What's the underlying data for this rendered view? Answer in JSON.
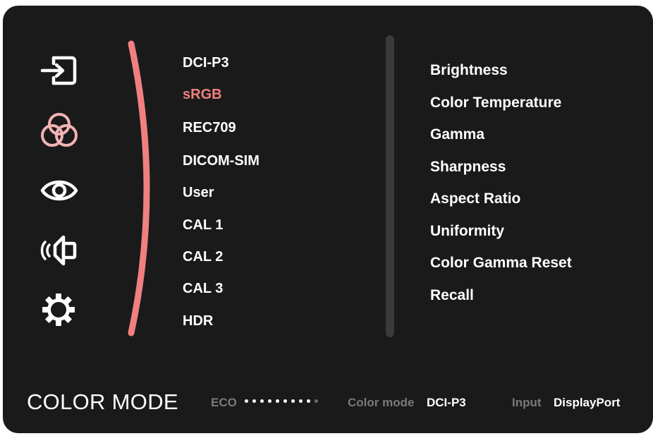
{
  "accent_color": "#f08080",
  "sidebar": {
    "icons": [
      {
        "name": "input-icon",
        "active": false
      },
      {
        "name": "color-icon",
        "active": true
      },
      {
        "name": "eye-icon",
        "active": false
      },
      {
        "name": "audio-icon",
        "active": false
      },
      {
        "name": "gear-icon",
        "active": false
      }
    ]
  },
  "color_modes": {
    "items": [
      "DCI-P3",
      "sRGB",
      "REC709",
      "DICOM-SIM",
      "User",
      "CAL 1",
      "CAL 2",
      "CAL 3",
      "HDR"
    ],
    "selected": "sRGB"
  },
  "settings": {
    "items": [
      "Brightness",
      "Color Temperature",
      "Gamma",
      "Sharpness",
      "Aspect Ratio",
      "Uniformity",
      "Color Gamma Reset",
      "Recall"
    ]
  },
  "footer": {
    "title": "COLOR MODE",
    "eco_label": "ECO",
    "eco_level": {
      "filled": 9,
      "total": 10
    },
    "color_mode_label": "Color mode",
    "color_mode_value": "DCI-P3",
    "input_label": "Input",
    "input_value": "DisplayPort"
  }
}
